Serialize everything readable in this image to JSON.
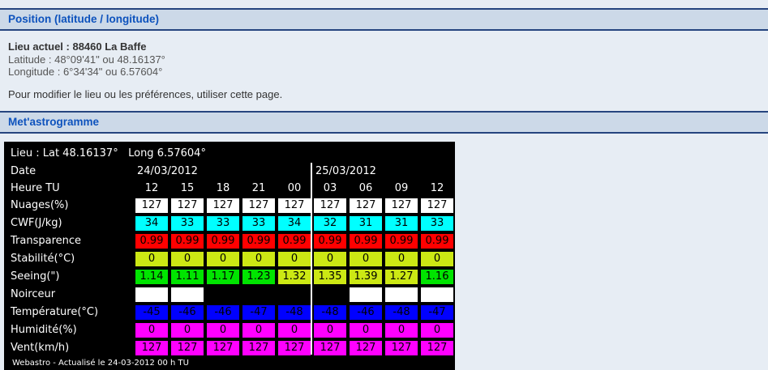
{
  "page": {
    "section1_title": "Position (latitude / longitude)",
    "section2_title": "Met'astrogramme",
    "location_line": "Lieu actuel : 88460 La Baffe",
    "latitude_line": "Latitude : 48°09'41\" ou 48.16137°",
    "longitude_line": "Longitude : 6°34'34\" ou 6.57604°",
    "modify_line": "Pour modifier le lieu ou les préférences, utiliser cette page.",
    "colors": {
      "page_bg": "#e7edf4",
      "bar_bg": "#ccd9e8",
      "bar_border": "#26457f",
      "bar_text": "#0d52bd"
    }
  },
  "meteogram": {
    "header": "Lieu : Lat 48.16137°   Long 6.57604°",
    "date_label": "Date",
    "hour_label": "Heure TU",
    "dates": [
      {
        "label": "24/03/2012",
        "span": 5
      },
      {
        "label": "25/03/2012",
        "span": 4
      }
    ],
    "hours": [
      "12",
      "15",
      "18",
      "21",
      "00",
      "03",
      "06",
      "09",
      "12"
    ],
    "rows": [
      {
        "label": "Nuages(%)",
        "values": [
          "127",
          "127",
          "127",
          "127",
          "127",
          "127",
          "127",
          "127",
          "127"
        ],
        "cell_colors": [
          "#ffffff",
          "#ffffff",
          "#ffffff",
          "#ffffff",
          "#ffffff",
          "#ffffff",
          "#ffffff",
          "#ffffff",
          "#ffffff"
        ]
      },
      {
        "label": "CWF(J/kg)",
        "values": [
          "34",
          "33",
          "33",
          "33",
          "34",
          "32",
          "31",
          "31",
          "33"
        ],
        "cell_colors": [
          "#00ffff",
          "#00ffff",
          "#00ffff",
          "#00ffff",
          "#00ffff",
          "#00ffff",
          "#00ffff",
          "#00ffff",
          "#00ffff"
        ]
      },
      {
        "label": "Transparence",
        "values": [
          "0.99",
          "0.99",
          "0.99",
          "0.99",
          "0.99",
          "0.99",
          "0.99",
          "0.99",
          "0.99"
        ],
        "cell_colors": [
          "#ff0000",
          "#ff0000",
          "#ff0000",
          "#ff0000",
          "#ff0000",
          "#ff0000",
          "#ff0000",
          "#ff0000",
          "#ff0000"
        ]
      },
      {
        "label": "Stabilité(°C)",
        "values": [
          "0",
          "0",
          "0",
          "0",
          "0",
          "0",
          "0",
          "0",
          "0"
        ],
        "cell_colors": [
          "#cce814",
          "#cce814",
          "#cce814",
          "#cce814",
          "#cce814",
          "#cce814",
          "#cce814",
          "#cce814",
          "#cce814"
        ]
      },
      {
        "label": "Seeing(\")",
        "values": [
          "1.14",
          "1.11",
          "1.17",
          "1.23",
          "1.32",
          "1.35",
          "1.39",
          "1.27",
          "1.16"
        ],
        "cell_colors": [
          "#00e400",
          "#00e400",
          "#00e400",
          "#00e400",
          "#cce814",
          "#cce814",
          "#cce814",
          "#cce814",
          "#00e400"
        ]
      },
      {
        "label": "Noirceur",
        "values": [
          "",
          "",
          "",
          "",
          "",
          "",
          "",
          "",
          ""
        ],
        "cell_colors": [
          "#ffffff",
          "#ffffff",
          "#000000",
          "#000000",
          "#000000",
          "#000000",
          "#ffffff",
          "#ffffff",
          "#ffffff"
        ]
      },
      {
        "label": "Température(°C)",
        "values": [
          "-45",
          "-46",
          "-46",
          "-47",
          "-48",
          "-48",
          "-46",
          "-48",
          "-47"
        ],
        "cell_colors": [
          "#0000ff",
          "#0000ff",
          "#0000ff",
          "#0000ff",
          "#0000ff",
          "#0000ff",
          "#0000ff",
          "#0000ff",
          "#0000ff"
        ]
      },
      {
        "label": "Humidité(%)",
        "values": [
          "0",
          "0",
          "0",
          "0",
          "0",
          "0",
          "0",
          "0",
          "0"
        ],
        "cell_colors": [
          "#ff00ff",
          "#ff00ff",
          "#ff00ff",
          "#ff00ff",
          "#ff00ff",
          "#ff00ff",
          "#ff00ff",
          "#ff00ff",
          "#ff00ff"
        ]
      },
      {
        "label": "Vent(km/h)",
        "values": [
          "127",
          "127",
          "127",
          "127",
          "127",
          "127",
          "127",
          "127",
          "127"
        ],
        "cell_colors": [
          "#ff00ff",
          "#ff00ff",
          "#ff00ff",
          "#ff00ff",
          "#ff00ff",
          "#ff00ff",
          "#ff00ff",
          "#ff00ff",
          "#ff00ff"
        ]
      }
    ],
    "footer": "Webastro - Actualisé le 24-03-2012 00 h TU"
  },
  "chart_data": {
    "type": "table",
    "title": "Met'astrogramme - Lieu : Lat 48.16137° Long 6.57604°",
    "dates": [
      "24/03/2012",
      "24/03/2012",
      "24/03/2012",
      "24/03/2012",
      "25/03/2012",
      "25/03/2012",
      "25/03/2012",
      "25/03/2012",
      "25/03/2012"
    ],
    "categories": [
      "12",
      "15",
      "18",
      "21",
      "00",
      "03",
      "06",
      "09",
      "12"
    ],
    "series": [
      {
        "name": "Nuages(%)",
        "values": [
          127,
          127,
          127,
          127,
          127,
          127,
          127,
          127,
          127
        ]
      },
      {
        "name": "CWF(J/kg)",
        "values": [
          34,
          33,
          33,
          33,
          34,
          32,
          31,
          31,
          33
        ]
      },
      {
        "name": "Transparence",
        "values": [
          0.99,
          0.99,
          0.99,
          0.99,
          0.99,
          0.99,
          0.99,
          0.99,
          0.99
        ]
      },
      {
        "name": "Stabilité(°C)",
        "values": [
          0,
          0,
          0,
          0,
          0,
          0,
          0,
          0,
          0
        ]
      },
      {
        "name": "Seeing(\")",
        "values": [
          1.14,
          1.11,
          1.17,
          1.23,
          1.32,
          1.35,
          1.39,
          1.27,
          1.16
        ]
      },
      {
        "name": "Noirceur",
        "values": [
          "blanc",
          "blanc",
          "noir",
          "noir",
          "noir",
          "noir",
          "blanc",
          "blanc",
          "blanc"
        ]
      },
      {
        "name": "Température(°C)",
        "values": [
          -45,
          -46,
          -46,
          -47,
          -48,
          -48,
          -46,
          -48,
          -47
        ]
      },
      {
        "name": "Humidité(%)",
        "values": [
          0,
          0,
          0,
          0,
          0,
          0,
          0,
          0,
          0
        ]
      },
      {
        "name": "Vent(km/h)",
        "values": [
          127,
          127,
          127,
          127,
          127,
          127,
          127,
          127,
          127
        ]
      }
    ]
  }
}
